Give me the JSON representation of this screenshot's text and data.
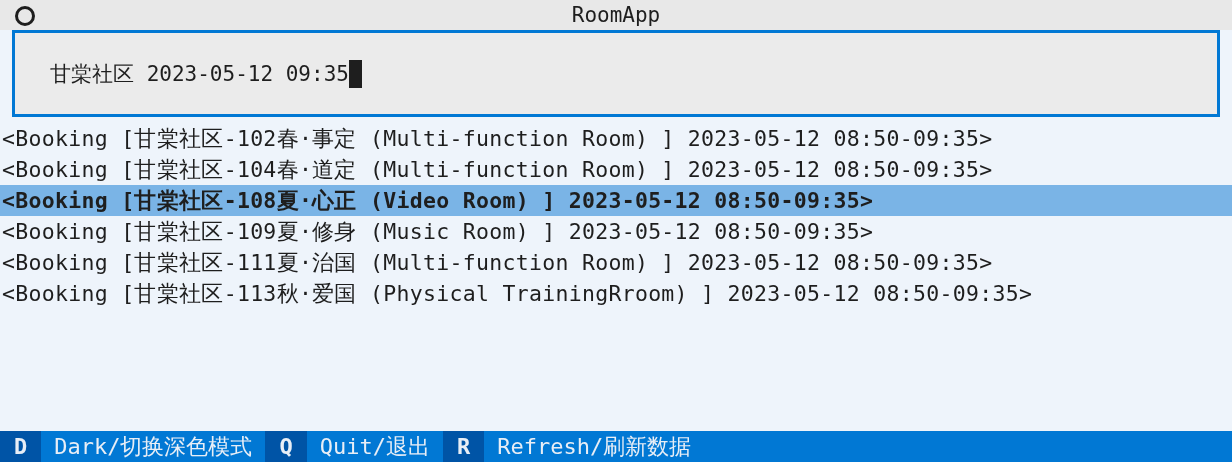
{
  "window": {
    "title": "RoomApp"
  },
  "search": {
    "value": "甘棠社区 2023-05-12 09:35"
  },
  "bookings": [
    {
      "text": "<Booking [甘棠社区-102春·事定 (Multi-function Room) ] 2023-05-12 08:50-09:35>",
      "selected": false
    },
    {
      "text": "<Booking [甘棠社区-104春·道定 (Multi-function Room) ] 2023-05-12 08:50-09:35>",
      "selected": false
    },
    {
      "text": "<Booking [甘棠社区-108夏·心正 (Video Room) ] 2023-05-12 08:50-09:35>",
      "selected": true
    },
    {
      "text": "<Booking [甘棠社区-109夏·修身 (Music Room) ] 2023-05-12 08:50-09:35>",
      "selected": false
    },
    {
      "text": "<Booking [甘棠社区-111夏·治国 (Multi-function Room) ] 2023-05-12 08:50-09:35>",
      "selected": false
    },
    {
      "text": "<Booking [甘棠社区-113秋·爱国 (Physical TrainingRroom) ] 2023-05-12 08:50-09:35>",
      "selected": false
    }
  ],
  "footer": [
    {
      "key": "D",
      "label": "Dark/切换深色模式"
    },
    {
      "key": "Q",
      "label": "Quit/退出"
    },
    {
      "key": "R",
      "label": "Refresh/刷新数据"
    }
  ]
}
